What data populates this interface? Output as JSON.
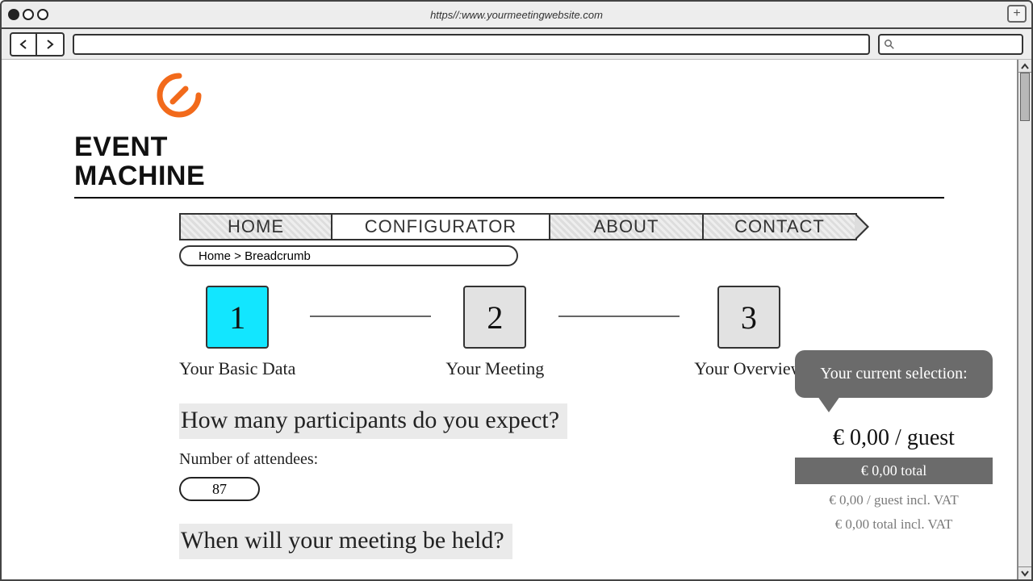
{
  "browser": {
    "url_display": "https//:www.yourmeetingwebsite.com",
    "newtab_label": "+"
  },
  "brand": {
    "line1": "EVENT",
    "line2": "MACHINE"
  },
  "nav": {
    "home": "HOME",
    "configurator": "CONFIGURATOR",
    "about": "ABOUT",
    "contact": "CONTACT"
  },
  "breadcrumb": "Home > Breadcrumb",
  "steps": [
    {
      "num": "1",
      "label": "Your Basic Data"
    },
    {
      "num": "2",
      "label": "Your Meeting"
    },
    {
      "num": "3",
      "label": "Your Overview"
    }
  ],
  "form": {
    "q1_heading": "How many participants do you expect?",
    "attendees_label": "Number of attendees:",
    "attendees_value": "87",
    "q2_heading": "When will your meeting be held?"
  },
  "selection": {
    "title": "Your current selection:",
    "per_guest": "€ 0,00 / guest",
    "total": "€ 0,00 total",
    "per_guest_vat": "€ 0,00 / guest incl. VAT",
    "total_vat": "€ 0,00 total incl. VAT"
  }
}
